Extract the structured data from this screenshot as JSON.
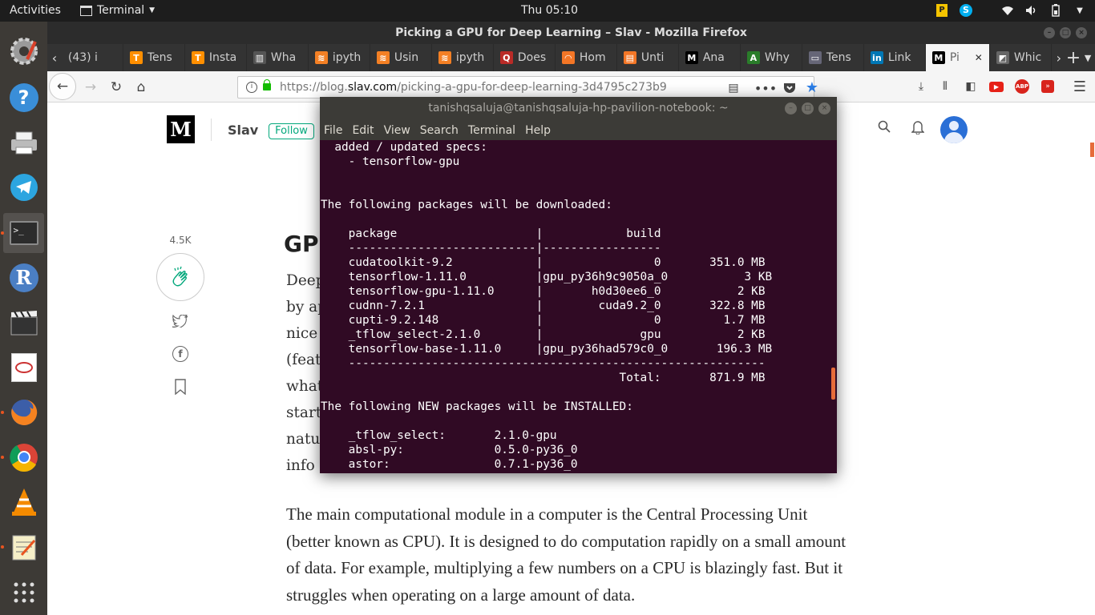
{
  "topbar": {
    "activities": "Activities",
    "app_menu": "Terminal",
    "clock": "Thu 05:10"
  },
  "firefox": {
    "window_title": "Picking a GPU for Deep Learning – Slav - Mozilla Firefox",
    "tabs": [
      {
        "label": "(43) i",
        "fav": "",
        "color": "#333"
      },
      {
        "label": "Tens",
        "fav": "T",
        "color": "#ff8f00"
      },
      {
        "label": "Insta",
        "fav": "T",
        "color": "#ff8f00"
      },
      {
        "label": "Wha",
        "fav": "▥",
        "color": "#555"
      },
      {
        "label": "ipyth",
        "fav": "≋",
        "color": "#f48024"
      },
      {
        "label": "Usin",
        "fav": "≋",
        "color": "#f48024"
      },
      {
        "label": "ipyth",
        "fav": "≋",
        "color": "#f48024"
      },
      {
        "label": "Does",
        "fav": "Q",
        "color": "#b92b27"
      },
      {
        "label": "Hom",
        "fav": "◠",
        "color": "#f37626"
      },
      {
        "label": "Unti",
        "fav": "▤",
        "color": "#f37626"
      },
      {
        "label": "Ana",
        "fav": "M",
        "color": "#000"
      },
      {
        "label": "Why",
        "fav": "A",
        "color": "#2a7d2a"
      },
      {
        "label": "Tens",
        "fav": "▭",
        "color": "#667"
      },
      {
        "label": "Link",
        "fav": "in",
        "color": "#0077b5"
      },
      {
        "label": "Pi",
        "fav": "M",
        "color": "#000",
        "active": true
      },
      {
        "label": "Whic",
        "fav": "◩",
        "color": "#666"
      }
    ],
    "url_base": "https://blog.",
    "url_host": "slav.com",
    "url_path": "/picking-a-gpu-for-deep-learning-3d4795c273b9"
  },
  "medium": {
    "logo": "M",
    "publication": "Slav",
    "follow": "Follow",
    "claps": "4.5K",
    "heading_fragment": "GPU",
    "para1_lines": [
      "Deep",
      "by ap",
      "nice",
      "(feat",
      "what",
      "start",
      "natu",
      "info"
    ],
    "para2": "The main computational module in a computer is the Central Processing Unit (better known as CPU). It is designed to do computation rapidly on a small amount of data. For example, multiplying a few numbers on a CPU is blazingly fast. But it struggles when operating on a large amount of data."
  },
  "terminal": {
    "title": "tanishqsaluja@tanishqsaluja-hp-pavilion-notebook: ~",
    "menu": [
      "File",
      "Edit",
      "View",
      "Search",
      "Terminal",
      "Help"
    ],
    "lines": [
      "  added / updated specs:",
      "    - tensorflow-gpu",
      "",
      "",
      "The following packages will be downloaded:",
      "",
      "    package                    |            build",
      "    ---------------------------|-----------------",
      "    cudatoolkit-9.2            |                0       351.0 MB",
      "    tensorflow-1.11.0          |gpu_py36h9c9050a_0           3 KB",
      "    tensorflow-gpu-1.11.0      |       h0d30ee6_0           2 KB",
      "    cudnn-7.2.1                |        cuda9.2_0       322.8 MB",
      "    cupti-9.2.148              |                0         1.7 MB",
      "    _tflow_select-2.1.0        |              gpu           2 KB",
      "    tensorflow-base-1.11.0     |gpu_py36had579c0_0       196.3 MB",
      "    ------------------------------------------------------------",
      "                                           Total:       871.9 MB",
      "",
      "The following NEW packages will be INSTALLED:",
      "",
      "    _tflow_select:       2.1.0-gpu",
      "    absl-py:             0.5.0-py36_0",
      "    astor:               0.7.1-py36_0",
      "    ..."
    ]
  }
}
